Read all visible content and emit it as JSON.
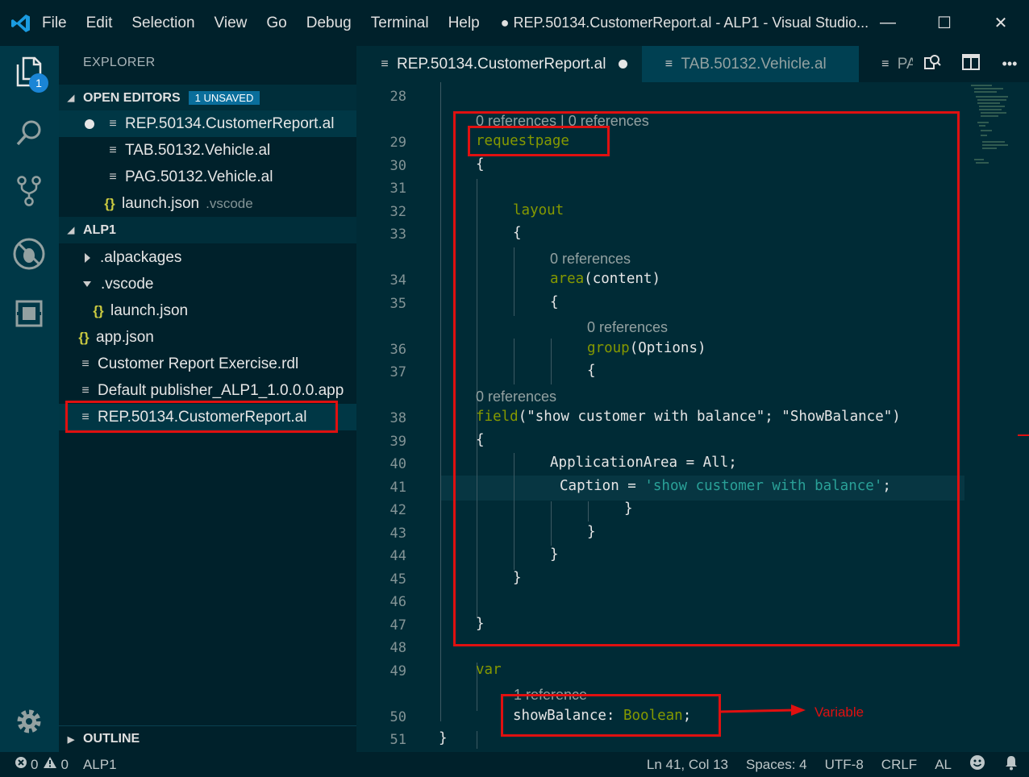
{
  "titlebar": {
    "menu": [
      "File",
      "Edit",
      "Selection",
      "View",
      "Go",
      "Debug",
      "Terminal",
      "Help"
    ],
    "title": "● REP.50134.CustomerReport.al - ALP1 - Visual Studio...",
    "minimize": "—",
    "maximize": "☐",
    "close": "✕"
  },
  "activity": {
    "badge": "1",
    "icons": [
      "explorer-icon",
      "search-icon",
      "source-control-icon",
      "debug-icon",
      "extensions-icon",
      "gear-icon"
    ]
  },
  "sidebar": {
    "title": "EXPLORER",
    "open_editors": {
      "label": "OPEN EDITORS",
      "badge": "1 UNSAVED",
      "items": [
        {
          "name": "REP.50134.CustomerReport.al",
          "suffix": ""
        },
        {
          "name": "TAB.50132.Vehicle.al",
          "suffix": ""
        },
        {
          "name": "PAG.50132.Vehicle.al",
          "suffix": ""
        },
        {
          "name": "launch.json",
          "suffix": ".vscode"
        }
      ]
    },
    "project": {
      "label": "ALP1",
      "items": [
        {
          "name": ".alpackages"
        },
        {
          "name": ".vscode"
        },
        {
          "name": "launch.json"
        },
        {
          "name": "app.json"
        },
        {
          "name": "Customer Report Exercise.rdl"
        },
        {
          "name": "Default publisher_ALP1_1.0.0.0.app"
        },
        {
          "name": "REP.50134.CustomerReport.al"
        }
      ]
    },
    "outline": "OUTLINE"
  },
  "tabs": [
    {
      "label": "REP.50134.CustomerReport.al"
    },
    {
      "label": "TAB.50132.Vehicle.al"
    },
    {
      "label": "PAC"
    }
  ],
  "editor": {
    "line_numbers": [
      "28",
      "29",
      "30",
      "31",
      "32",
      "33",
      "34",
      "35",
      "36",
      "37",
      "38",
      "39",
      "40",
      "41",
      "42",
      "43",
      "44",
      "45",
      "46",
      "47",
      "48",
      "49",
      "50",
      "51"
    ],
    "lens": {
      "l29": "0 references | 0 references",
      "l34": "0 references",
      "l36": "0 references",
      "l38": "0 references",
      "l50": "1 reference"
    },
    "code": {
      "l29": "requestpage",
      "l30": "{",
      "l32": "layout",
      "l33": "{",
      "l34_kw": "area",
      "l34_rest": "(content)",
      "l35": "{",
      "l36_kw": "group",
      "l36_rest": "(Options)",
      "l37": "{",
      "l38_kw": "field",
      "l38_rest": "(\"show customer with balance\"; \"ShowBalance\")",
      "l39": "{",
      "l40": "ApplicationArea = All;",
      "l41_a": "Caption = ",
      "l41_str": "'show customer with balance'",
      "l41_b": ";",
      "l42": "}",
      "l43": "}",
      "l44": "}",
      "l45": "}",
      "l47": "}",
      "l49": "var",
      "l50_a": "showBalance: ",
      "l50_type": "Boolean",
      "l50_b": ";",
      "l51": "}"
    }
  },
  "annotation": {
    "label": "Variable",
    "color": "#e01010"
  },
  "statusbar": {
    "errors": "0",
    "warnings": "0",
    "project": "ALP1",
    "position": "Ln 41, Col 13",
    "spaces": "Spaces: 4",
    "encoding": "UTF-8",
    "eol": "CRLF",
    "language": "AL"
  }
}
